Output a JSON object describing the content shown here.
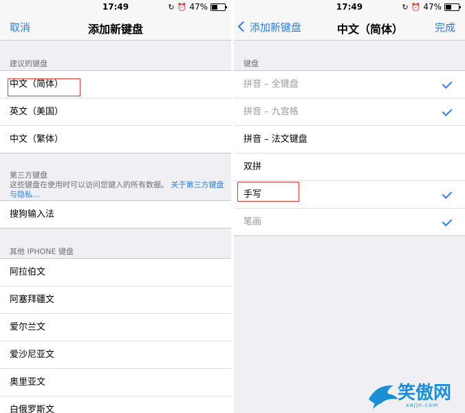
{
  "left": {
    "status": {
      "time": "17:49",
      "battery": "47%"
    },
    "nav": {
      "cancel": "取消",
      "title": "添加新键盘"
    },
    "suggested": {
      "header": "建议的键盘",
      "items": [
        "中文（简体）",
        "英文（美国）",
        "中文（繁体）"
      ]
    },
    "third_party": {
      "header": "第三方键盘",
      "desc": "这些键盘在使用时可以访问您键入的所有数据。",
      "link": "关于第三方键盘与隐私…",
      "items": [
        "搜狗输入法"
      ]
    },
    "other": {
      "header": "其他 IPHONE 键盘",
      "items": [
        "阿拉伯文",
        "阿塞拜疆文",
        "爱尔兰文",
        "爱沙尼亚文",
        "奥里亚文",
        "白俄罗斯文"
      ]
    }
  },
  "right": {
    "status": {
      "time": "17:49",
      "battery": "47%"
    },
    "nav": {
      "back": "添加新键盘",
      "title": "中文（简体）",
      "done": "完成"
    },
    "keyboards": {
      "header": "键盘",
      "items": [
        {
          "label": "拼音 – 全键盘",
          "checked": true,
          "disabled": true
        },
        {
          "label": "拼音 – 九宫格",
          "checked": true,
          "disabled": true
        },
        {
          "label": "拼音 – 法文键盘",
          "checked": false,
          "disabled": false
        },
        {
          "label": "双拼",
          "checked": false,
          "disabled": false
        },
        {
          "label": "手写",
          "checked": true,
          "disabled": false
        },
        {
          "label": "笔画",
          "checked": true,
          "disabled": true
        }
      ]
    }
  },
  "watermark": {
    "brand": "笑傲网",
    "url": "xajjn.com"
  },
  "colors": {
    "accent": "#2a7de1",
    "highlight": "#e0353a",
    "background": "#efeff4"
  }
}
